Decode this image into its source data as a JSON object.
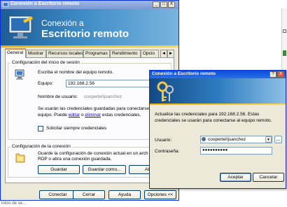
{
  "main_window": {
    "title": "Conexión a Escritorio remoto",
    "minimize": "_",
    "maximize": "□",
    "close": "X",
    "banner_line1": "Conexión a",
    "banner_line2": "Escritorio remoto",
    "tabs": [
      {
        "label": "General",
        "active": true
      },
      {
        "label": "Mostrar",
        "active": false
      },
      {
        "label": "Recursos locales",
        "active": false
      },
      {
        "label": "Programas",
        "active": false
      },
      {
        "label": "Rendimiento",
        "active": false
      },
      {
        "label": "Opcio",
        "active": false
      }
    ],
    "tab_scroll_left": "◄",
    "tab_scroll_right": "►",
    "login_group": {
      "legend": "Configuración del inicio de sesión",
      "instruction": "Escriba el nombre del equipo remoto.",
      "computer_label": "Equipo:",
      "computer_value": "192.168.2.56",
      "username_label": "Nombre de usuario:",
      "username_value": "coopertel\\jsanchez",
      "note_line1": "Se usarán las credenciales guardadas para conectarse a",
      "note_line2_prefix": "equipo.  Puede",
      "edit_link": "editar",
      "or_text": "o",
      "delete_link": "eliminar",
      "note_line2_suffix": "estas credenciales.",
      "always_ask_label": "Solicitar siempre credenciales",
      "always_ask_checked": false
    },
    "connection_group": {
      "legend": "Configuración de la conexión",
      "text_line1": "Guarde la configuración de conexión actual en un arch",
      "text_line2": "RDP o abra una conexión guardada.",
      "save_label": "Guardar",
      "save_as_label": "Guardar como...",
      "open_label": "Abri"
    },
    "buttons": {
      "connect": "Conectar",
      "close": "Cerrar",
      "help": "Ayuda",
      "options": "Opciones <<"
    },
    "status_fragment": "inicio de se..."
  },
  "credentials_dialog": {
    "title": "Conexión a Escritorio remoto",
    "help_button": "?",
    "close_button": "X",
    "message_line1": "Actualice las credenciales para 192.168.2.56. Estas",
    "message_line2": "credenciales se usarán para conectarse al equipo remoto.",
    "user_label": "Usuario:",
    "user_value": "coopertel\\jsanchez",
    "password_label": "Contraseña:",
    "password_value": "●●●●●●●●●●",
    "browse_button": "...",
    "accept_label": "Aceptar",
    "cancel_label": "Cancelar"
  },
  "colors": {
    "title_bar_active": "#0a4fd8",
    "title_bar_inactive": "#9fb7e8",
    "banner": "#2d7cc0",
    "accent_stripe": "#f0b000"
  }
}
